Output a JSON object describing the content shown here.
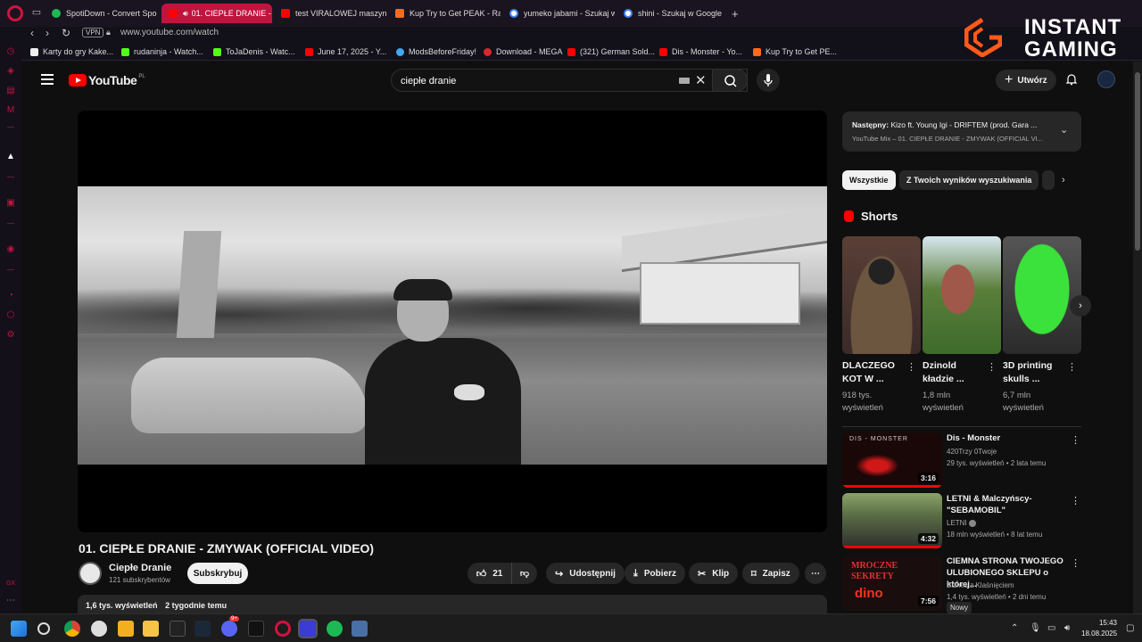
{
  "browser": {
    "tabs": [
      {
        "label": "SpotiDown - Convert Spo",
        "favicon": "spotify-icon"
      },
      {
        "label": "01. CIEPŁE DRANIE - ",
        "favicon": "youtube-audio-icon",
        "active": true
      },
      {
        "label": "test VIRALOWEJ maszyny",
        "favicon": "youtube-icon"
      },
      {
        "label": "Kup Try to Get PEAK - Ra",
        "favicon": "instant-gaming-icon"
      },
      {
        "label": "yumeko jabami - Szukaj w",
        "favicon": "google-icon"
      },
      {
        "label": "shini - Szukaj w Google",
        "favicon": "google-icon"
      }
    ],
    "new_tab": "+",
    "vpn_label": "VPN",
    "url": "www.youtube.com/watch",
    "bookmarks": [
      "Karty do gry Kake...",
      "rudaninja - Watch...",
      "ToJaDenis - Watc...",
      "June 17, 2025 - Y...",
      "ModsBeforeFriday!",
      "Download - MEGA",
      "(321) German Sold...",
      "Dis - Monster - Yo...",
      "Kup Try to Get PE..."
    ],
    "sidebar_footer": "GX"
  },
  "overlay": {
    "brand_line1": "INSTANT",
    "brand_line2": "GAMING"
  },
  "youtube": {
    "logo_text": "YouTube",
    "region": "PL",
    "search_value": "ciepłe dranie",
    "create_label": "Utwórz",
    "avatar_label": "Switch",
    "video": {
      "title": "01. CIEPŁE DRANIE - ZMYWAK (OFFICIAL VIDEO)",
      "channel": "Ciepłe Dranie",
      "subscribers": "121 subskrybentów",
      "subscribe_label": "Subskrybuj",
      "likes": "21",
      "share_label": "Udostępnij",
      "download_label": "Pobierz",
      "clip_label": "Klip",
      "save_label": "Zapisz",
      "more_label": "⋯",
      "views": "1,6 tys. wyświetleń",
      "age": "2 tygodnie temu"
    },
    "up_next": {
      "prefix": "Następny:",
      "title": "Kizo ft. Young Igi - DRIFTEM (prod. Gara ...",
      "subtitle": "YouTube Mix – 01. CIEPŁE DRANIE - ZMYWAK (OFFICIAL VI..."
    },
    "chips": [
      "Wszystkie",
      "Z Twoich wyników wyszukiwania"
    ],
    "shorts_heading": "Shorts",
    "shorts": [
      {
        "title1": "DLACZEGO",
        "title2": "KOT W ...",
        "views1": "918 tys.",
        "views2": "wyświetleń"
      },
      {
        "title1": "Dzinold",
        "title2": "kładzie ...",
        "views1": "1,8 mln",
        "views2": "wyświetleń"
      },
      {
        "title1": "3D printing",
        "title2": "skulls ...",
        "views1": "6,7 mln",
        "views2": "wyświetleń"
      }
    ],
    "recommendations": [
      {
        "title": "Dis - Monster",
        "channel": "420Trzy 0Twoje",
        "meta": "29 tys. wyświetleń • 2 lata temu",
        "duration": "3:16",
        "thumb_text": "DIS - MONSTER"
      },
      {
        "title": "LETNI & Malczyńscy- \"SEBAMOBIL\"",
        "channel": "LETNI",
        "meta": "18 mln wyświetleń • 8 lat temu",
        "duration": "4:32",
        "thumb_text": ""
      },
      {
        "title": "CIEMNA STRONA TWOJEGO ULUBIONEGO SKLEPU o której...",
        "channel": "Biznes z Klaśnięciem",
        "meta": "1,4 tys. wyświetleń • 2 dni temu",
        "duration": "7:56",
        "badge": "Nowy",
        "thumb_text": "MROCZNE SEKRETY",
        "thumb_text2": "dino"
      }
    ]
  },
  "taskbar": {
    "time": "15:43",
    "date": "18.08.2025",
    "discord_badge": "9+"
  },
  "colors": {
    "opera_red": "#c2133f",
    "yt_red": "#ff0000",
    "background": "#0f0f0f"
  }
}
